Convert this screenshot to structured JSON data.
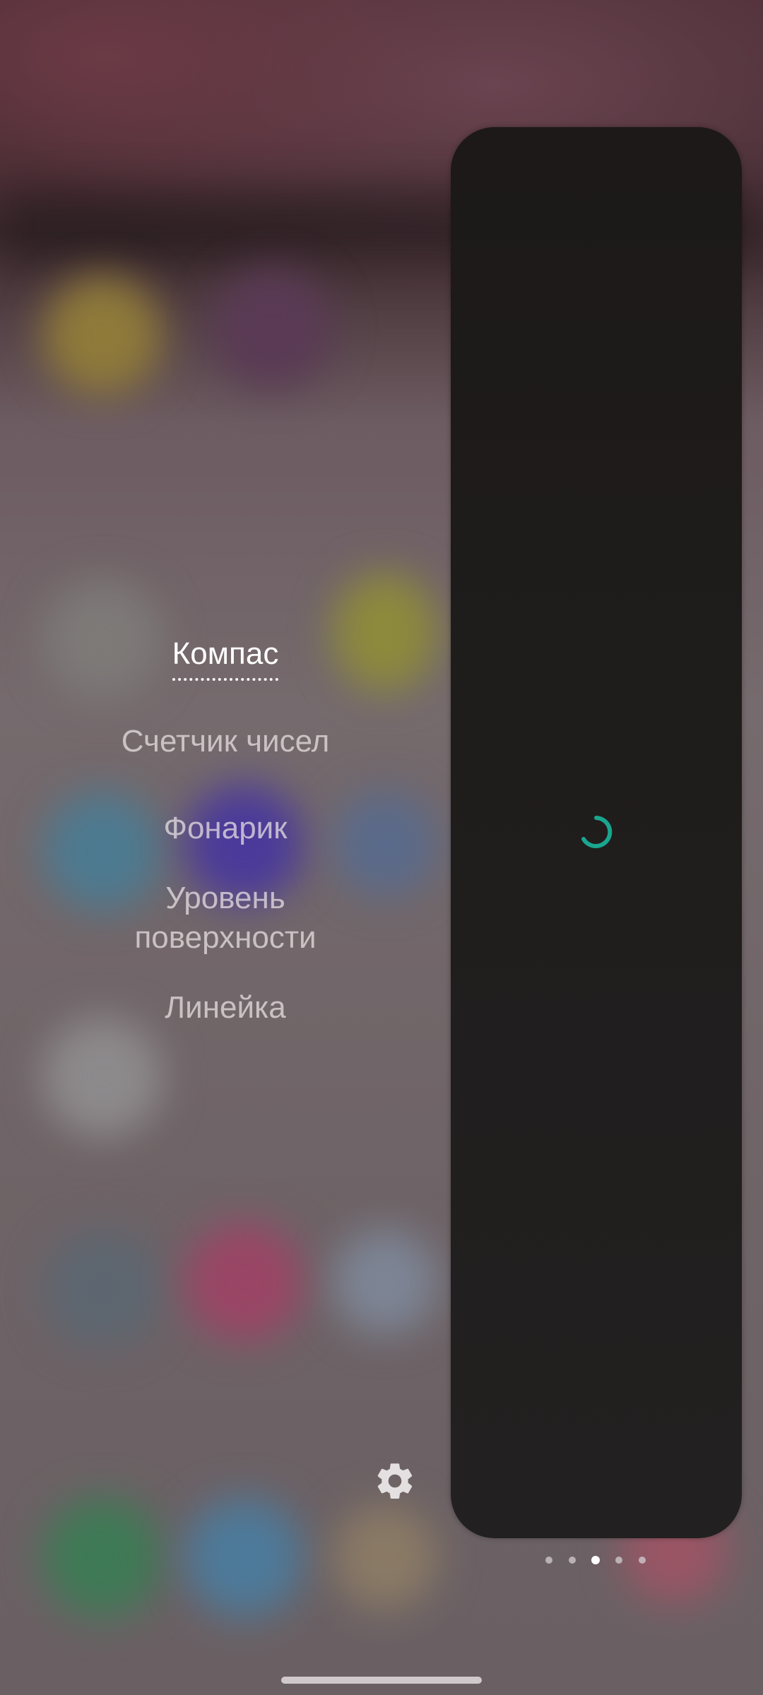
{
  "menu": {
    "items": [
      {
        "label": "Компас",
        "active": true
      },
      {
        "label": "Счетчик чисел",
        "active": false
      },
      {
        "label": "Фонарик",
        "active": false
      },
      {
        "label": "Уровень поверхности",
        "active": false
      },
      {
        "label": "Линейка",
        "active": false
      }
    ]
  },
  "panel": {
    "loading": true,
    "spinner_color": "#1aa58f"
  },
  "settings": {
    "icon": "gear-icon"
  },
  "pager": {
    "count": 5,
    "active_index": 2
  },
  "colors": {
    "active_text": "#ffffff",
    "inactive_text": "#e6dfe2",
    "panel_bg": "#1f1c1c"
  }
}
